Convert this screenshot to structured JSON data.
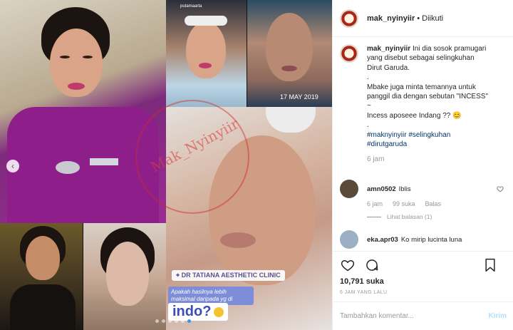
{
  "post": {
    "username": "mak_nyinyiir",
    "separator": "•",
    "follow_status": "Diikuti",
    "caption_lines": [
      "Ini dia sosok pramugari",
      "yang disebut sebagai selingkuhan",
      "Dirut Garuda.",
      ".",
      "Mbake juga minta temannya untuk",
      "panggil dia dengan sebutan \"INCESS\"",
      "~",
      "Incess aposeee Indang ?? 😊",
      ".",
      "#maknyinyiir #selingkuhan",
      "#dirutgaruda"
    ],
    "caption_time": "6 jam"
  },
  "comments": [
    {
      "user": "amn0502",
      "text": "Iblis",
      "time": "6 jam",
      "likes": "99 suka",
      "reply": "Balas",
      "view_replies": "Lihat balasan (1)",
      "avatar_color": "#5b4a3a"
    },
    {
      "user": "eka.apr03",
      "text": "Ko mirip lucinta luna",
      "avatar_color": "#9bb0c4"
    }
  ],
  "engagement": {
    "likes": "10,791 suka",
    "posted": "6 JAM YANG LALU"
  },
  "add_comment": {
    "placeholder": "Tambahkan komentar...",
    "send": "Kirim"
  },
  "media": {
    "watermark": "Mak_Nyinyiir",
    "clinic_tag": "DR TATIANA AESTHETIC CLINIC",
    "caption_small": "Apakah hasilnya lebih maksimal daripada yg di",
    "caption_big": "indo?",
    "date_stamp": "17 MAY 2019",
    "story_user": "putamaarta",
    "carousel_count": 6,
    "carousel_active": 5
  },
  "icons": {
    "heart": "heart-icon",
    "comment": "comment-icon",
    "bookmark": "bookmark-icon",
    "prev": "chevron-left-icon"
  },
  "colors": {
    "link": "#003569",
    "muted": "#999999",
    "send_disabled": "#b2dffc",
    "carousel_active": "#3897f0"
  }
}
